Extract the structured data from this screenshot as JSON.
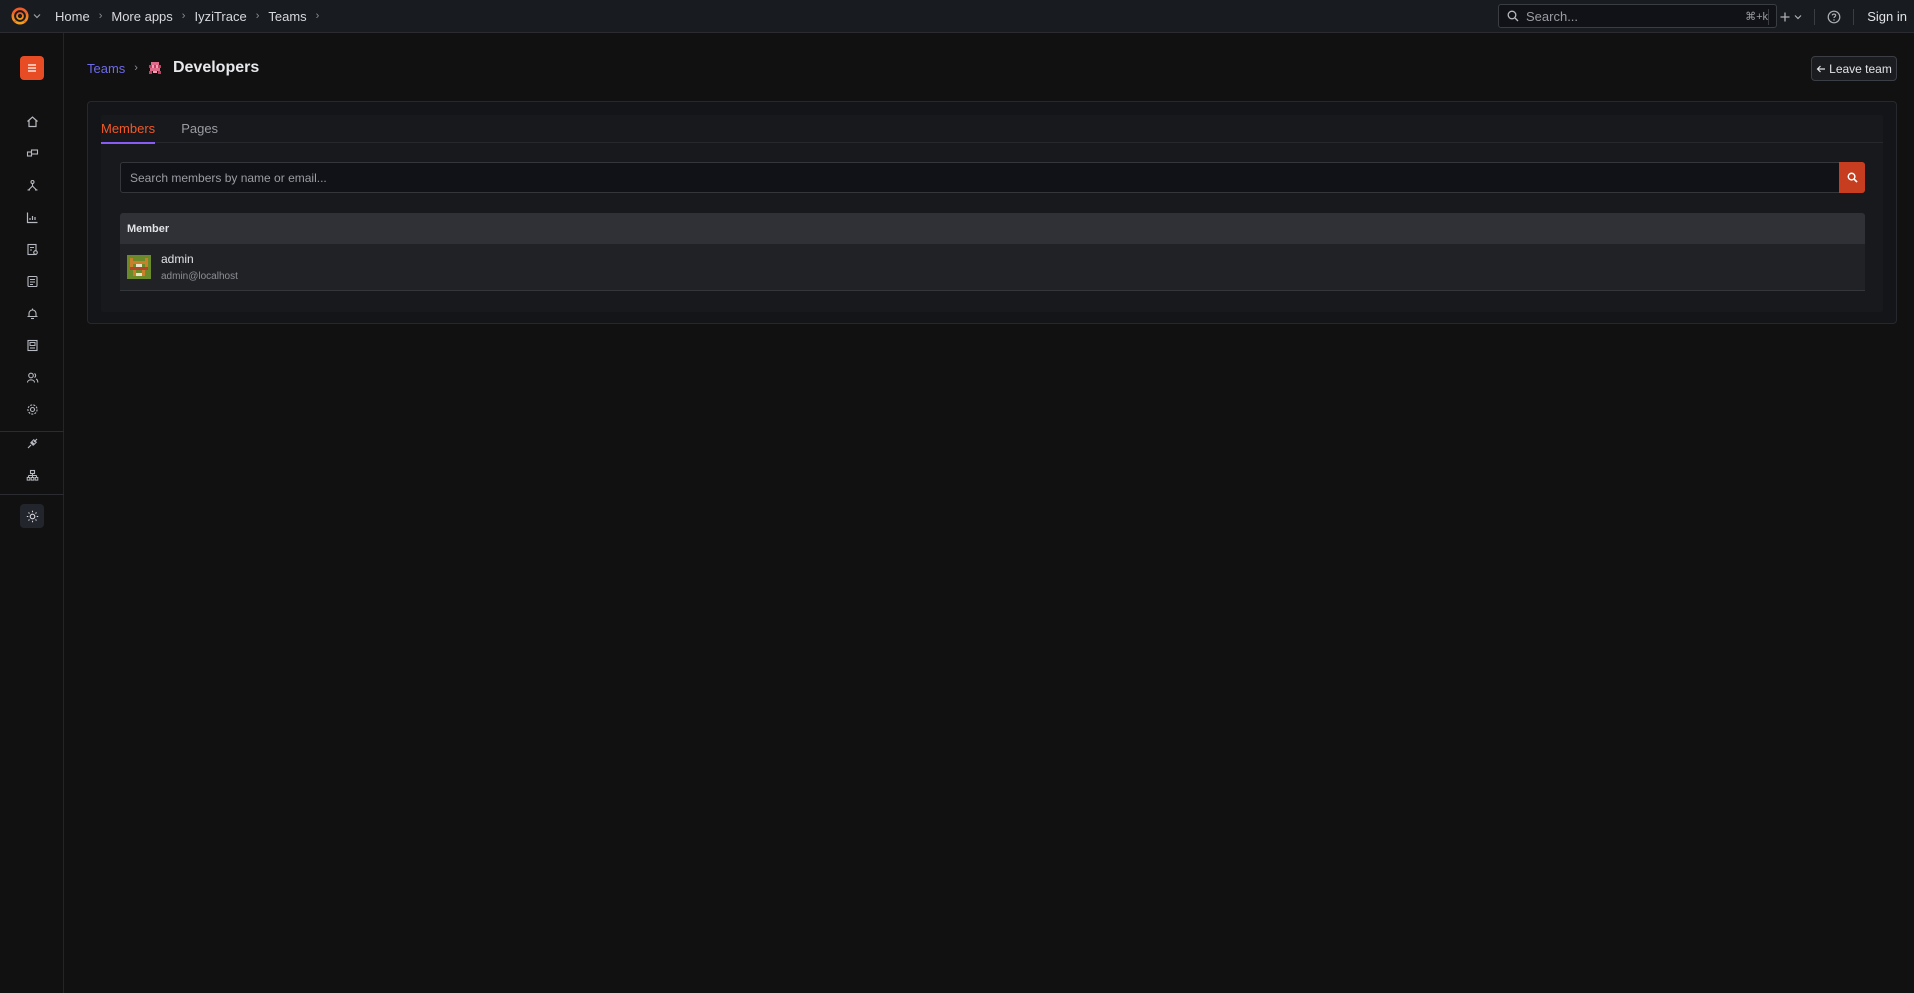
{
  "topbar": {
    "breadcrumbs": [
      "Home",
      "More apps",
      "IyziTrace",
      "Teams"
    ],
    "search_placeholder": "Search...",
    "search_shortcut": "⌘+k",
    "sign_in": "Sign in"
  },
  "page": {
    "parent_link": "Teams",
    "title": "Developers",
    "leave_button": "Leave team"
  },
  "tabs": [
    {
      "label": "Members",
      "active": true
    },
    {
      "label": "Pages",
      "active": false
    }
  ],
  "member_search": {
    "placeholder": "Search members by name or email..."
  },
  "table": {
    "header": "Member",
    "rows": [
      {
        "name": "admin",
        "email": "admin@localhost"
      }
    ]
  },
  "colors": {
    "accent": "#e74c24",
    "tab_active_text": "#f05a28",
    "tab_underline": "#8a5cf6",
    "link": "#6e6ae8"
  },
  "sidebar_icons": [
    "home-icon",
    "dashboards-icon",
    "explore-icon",
    "metrics-icon",
    "reports-icon",
    "documents-icon",
    "alerting-icon",
    "ledger-icon",
    "users-icon",
    "settings-icon",
    "connections-icon",
    "org-chart-icon"
  ]
}
